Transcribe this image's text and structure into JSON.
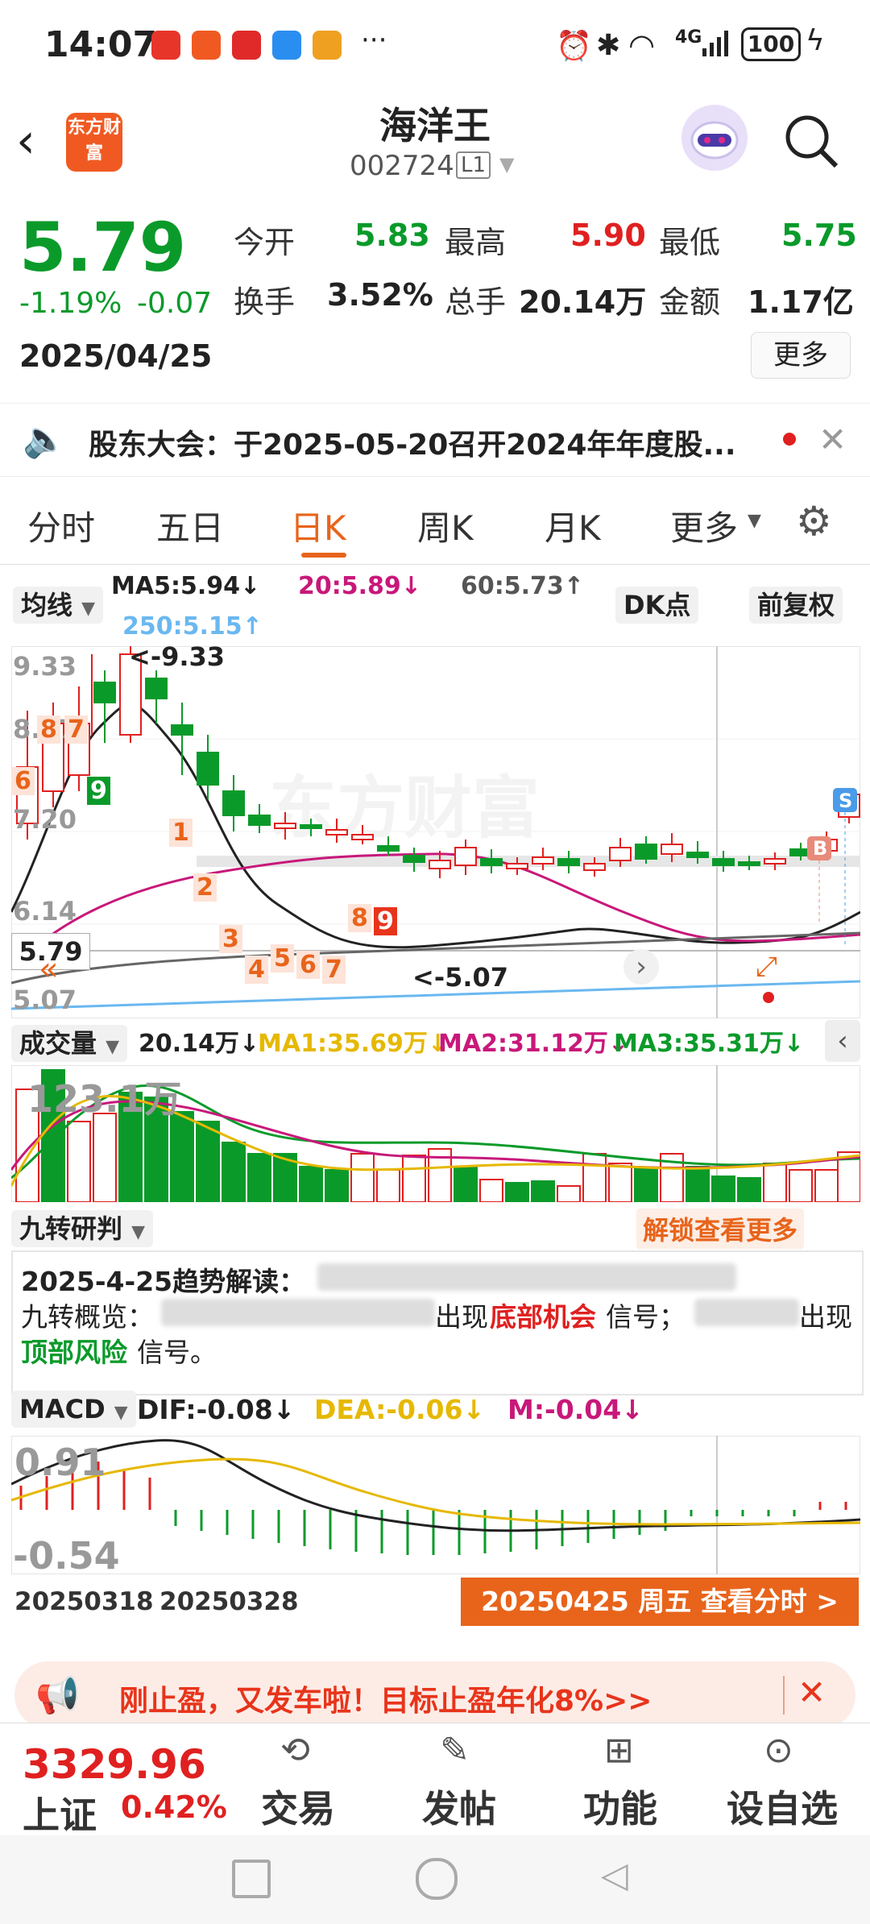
{
  "status_bar": {
    "time": "14:07",
    "more": "···",
    "network": "4G",
    "battery": "100"
  },
  "header": {
    "title": "海洋王",
    "code": "002724",
    "level": "L1",
    "logo_text": "东方财富"
  },
  "quote": {
    "price": "5.79",
    "change_pct": "-1.19%",
    "change": "-0.07",
    "date": "2025/04/25",
    "open_label": "今开",
    "open": "5.83",
    "high_label": "最高",
    "high": "5.90",
    "low_label": "最低",
    "low": "5.75",
    "turnover_label": "换手",
    "turnover": "3.52%",
    "volume_label": "总手",
    "volume": "20.14万",
    "amount_label": "金额",
    "amount": "1.17亿",
    "more_button": "更多"
  },
  "notice": {
    "text": "股东大会：于2025-05-20召开2024年年度股..."
  },
  "tabs": [
    "分时",
    "五日",
    "日K",
    "周K",
    "月K",
    "更多"
  ],
  "active_tab": "日K",
  "kline": {
    "indicator_select": "均线",
    "ma5": "MA5:5.94↓",
    "ma20": "20:5.89↓",
    "ma60": "60:5.73↑",
    "ma250": "250:5.15↑",
    "dk_button": "DK点",
    "adjust_button": "前复权",
    "y_labels": [
      "9.33",
      "8.27",
      "7.20",
      "6.14",
      "5.07"
    ],
    "current_price_tag": "5.79",
    "max_label": "<-9.33",
    "min_label": "<-5.07",
    "watermark": "东方财富",
    "markers": {
      "sell": "S",
      "buy": "B"
    },
    "nine_turn_numbers": [
      "6",
      "8",
      "7",
      "9",
      "1",
      "2",
      "3",
      "4",
      "5",
      "6",
      "7",
      "8",
      "9"
    ]
  },
  "volume_panel": {
    "select": "成交量",
    "value": "20.14万↓",
    "ma1": "MA1:35.69万↓",
    "ma2": "MA2:31.12万↓",
    "ma3": "MA3:35.31万↓",
    "y_label": "123.1万"
  },
  "nine_panel": {
    "select": "九转研判",
    "unlock": "解锁查看更多",
    "line1_label": "2025-4-25趋势解读：",
    "line2_label": "九转概览：",
    "line2_mid": "出现",
    "bottom_chance": "底部机会",
    "signal1": "信号；",
    "line2_mid2": "出现",
    "top_risk": "顶部风险",
    "signal2": "信号。"
  },
  "macd_panel": {
    "select": "MACD",
    "dif": "DIF:-0.08↓",
    "dea": "DEA:-0.06↓",
    "m": "M:-0.04↓",
    "y_top": "0.91",
    "y_bottom": "-0.54",
    "date1": "20250318",
    "date2": "20250328",
    "view_button": "20250425 周五 查看分时 >"
  },
  "promo": {
    "text": "刚止盈，又发车啦！目标止盈年化8%>>"
  },
  "bottom_nav": {
    "index_value": "3329.96",
    "index_name": "上证",
    "index_change": "0.42%",
    "items": [
      "交易",
      "发帖",
      "功能",
      "设自选"
    ]
  },
  "colors": {
    "accent": "#e8641b",
    "up": "#e02020",
    "down": "#0a9a2a",
    "ma20": "#c8187a",
    "ma250": "#6ab8f0",
    "ma_yellow": "#e6b800"
  }
}
